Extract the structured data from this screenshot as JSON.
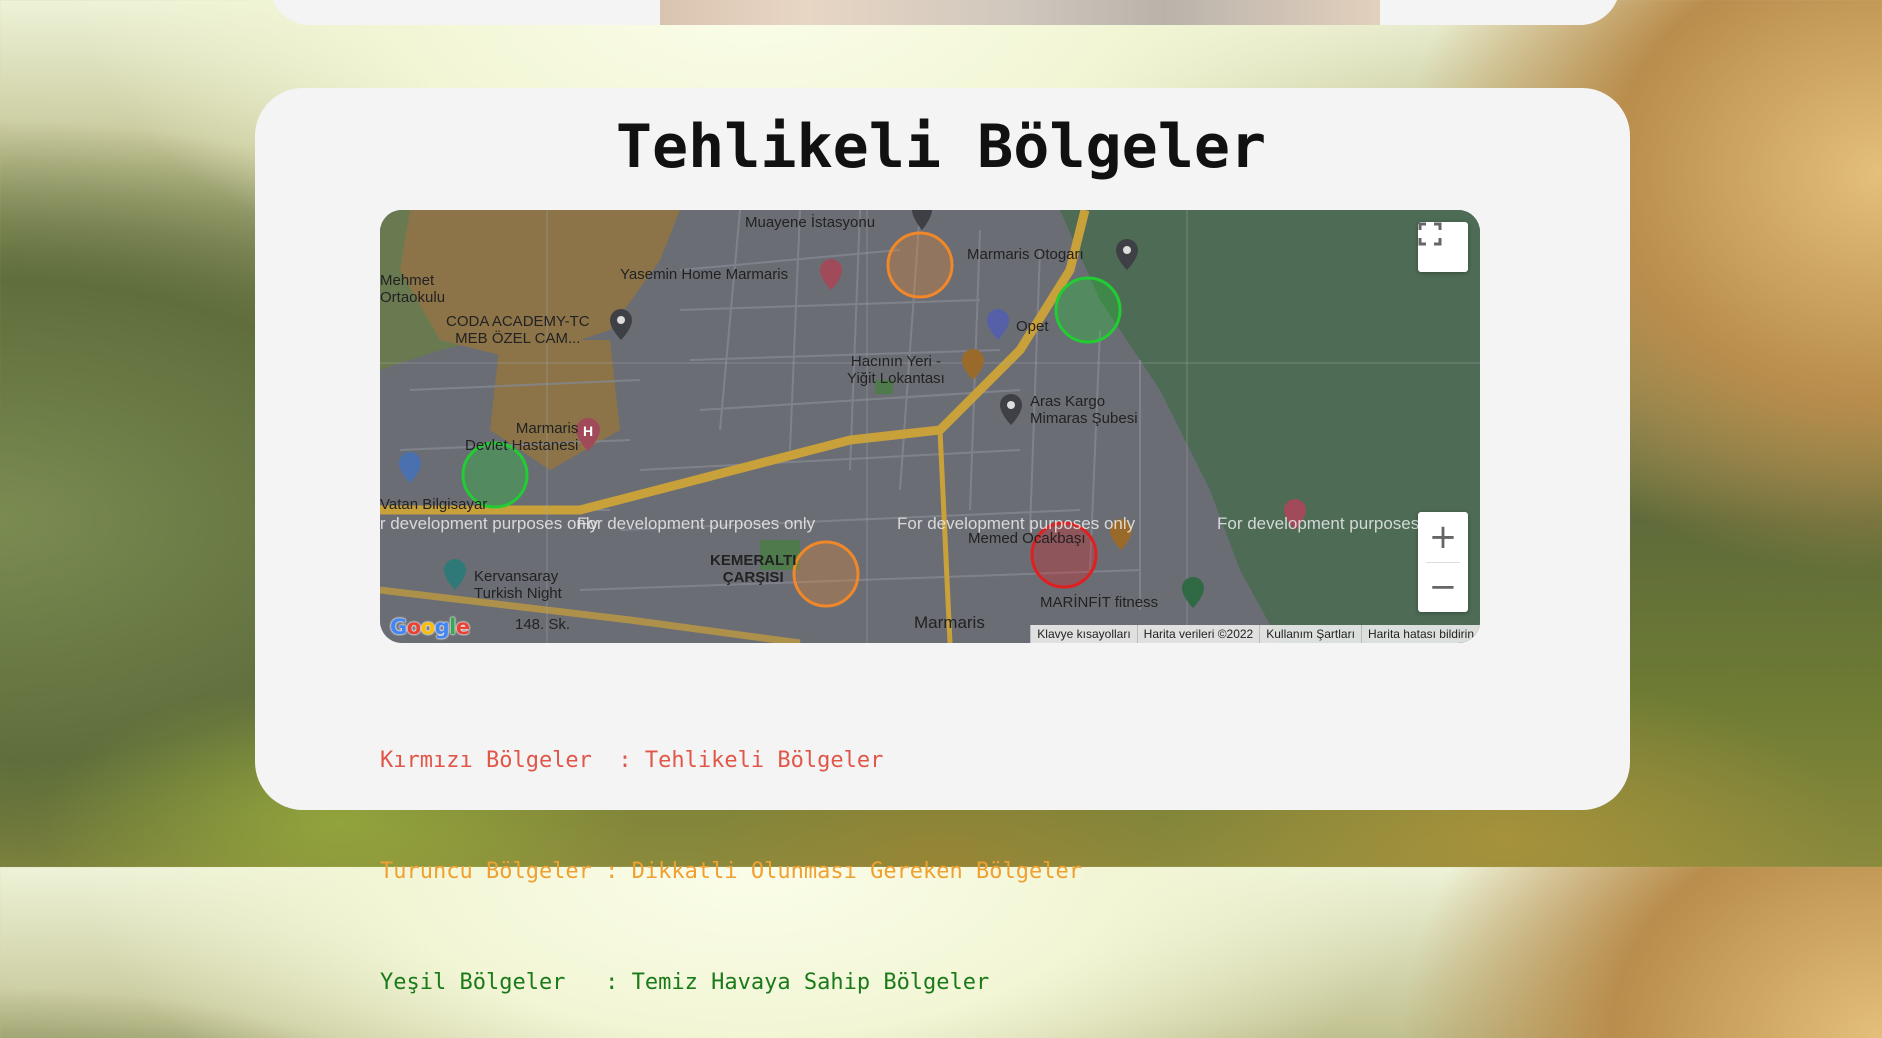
{
  "page": {
    "title": "Tehlikeli Bölgeler"
  },
  "map": {
    "fullscreen_icon": "fullscreen-icon",
    "zoom_in_label": "+",
    "zoom_out_label": "−",
    "logo_text": "Google",
    "dev_watermark": "For development purposes only",
    "attribution": [
      "Klavye kısayolları",
      "Harita verileri ©2022",
      "Kullanım Şartları",
      "Harita hatası bildirin"
    ],
    "labels": [
      {
        "key": "muayene",
        "text": "Muayene İstasyonu"
      },
      {
        "key": "yasemin",
        "text": "Yasemin Home Marmaris"
      },
      {
        "key": "otogar",
        "text": "Marmaris Otogarı"
      },
      {
        "key": "mehmet",
        "text": "Mehmet\nOrtaokulu"
      },
      {
        "key": "coda",
        "text": "CODA ACADEMY-TC\nMEB ÖZEL CAM..."
      },
      {
        "key": "opet",
        "text": "Opet"
      },
      {
        "key": "hacinin",
        "text": "Hacının Yeri -\nYiğit Lokantası"
      },
      {
        "key": "araskargo",
        "text": "Aras Kargo\nMimaras Şubesi"
      },
      {
        "key": "devlet",
        "text": "Marmaris\nDevlet Hastanesi"
      },
      {
        "key": "vatan",
        "text": "Vatan Bilgisayar"
      },
      {
        "key": "kervansaray",
        "text": "Kervansaray\nTurkish Night"
      },
      {
        "key": "kemeralti",
        "text": "KEMERALTI\nÇARŞISI"
      },
      {
        "key": "memed",
        "text": "Memed Ocakbaşı"
      },
      {
        "key": "marinfit",
        "text": "MARİNFİT fitness"
      },
      {
        "key": "marmaris",
        "text": "Marmaris"
      },
      {
        "key": "s148",
        "text": "148. Sk."
      }
    ],
    "zones": [
      {
        "level": "orange",
        "color": "#f0882a"
      },
      {
        "level": "green",
        "color": "#22cc33"
      },
      {
        "level": "green",
        "color": "#22cc33"
      },
      {
        "level": "red",
        "color": "#e02020"
      },
      {
        "level": "orange",
        "color": "#f0882a"
      }
    ]
  },
  "legend": [
    {
      "label": "Kırmızı Bölgeler  ",
      "desc": ": Tehlikeli Bölgeler",
      "color": "#e0574a"
    },
    {
      "label": "Turuncu Bölgeler ",
      "desc": ": Dikkatli Olunması Gereken Bölgeler",
      "color": "#f0a030"
    },
    {
      "label": "Yeşil Bölgeler   ",
      "desc": ": Temiz Havaya Sahip Bölgeler",
      "color": "#1a7a1a"
    }
  ]
}
